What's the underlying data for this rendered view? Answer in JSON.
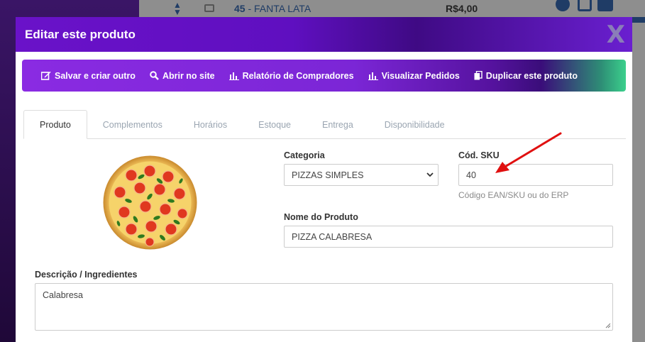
{
  "background_row": {
    "code": "45",
    "separator": " - ",
    "name": "FANTA LATA",
    "price": "R$4,00"
  },
  "modal": {
    "title": "Editar este produto",
    "close_label": "X"
  },
  "toolbar": {
    "items": [
      {
        "label": "Salvar e criar outro",
        "icon": "edit-icon"
      },
      {
        "label": "Abrir no site",
        "icon": "search-icon"
      },
      {
        "label": "Relatório de Compradores",
        "icon": "bar-chart-icon"
      },
      {
        "label": "Visualizar Pedidos",
        "icon": "bar-chart-icon"
      },
      {
        "label": "Duplicar este produto",
        "icon": "copy-icon"
      }
    ]
  },
  "tabs": [
    {
      "label": "Produto",
      "active": true
    },
    {
      "label": "Complementos",
      "active": false
    },
    {
      "label": "Horários",
      "active": false
    },
    {
      "label": "Estoque",
      "active": false
    },
    {
      "label": "Entrega",
      "active": false
    },
    {
      "label": "Disponibilidade",
      "active": false
    }
  ],
  "form": {
    "categoria_label": "Categoria",
    "categoria_value": "PIZZAS SIMPLES",
    "sku_label": "Cód. SKU",
    "sku_value": "40",
    "sku_help": "Código EAN/SKU ou do ERP",
    "nome_label": "Nome do Produto",
    "nome_value": "PIZZA CALABRESA",
    "descricao_label": "Descrição / Ingredientes",
    "descricao_value": "Calabresa"
  },
  "colors": {
    "header_purple": "#6a12c9",
    "toolbar_start": "#8a2be2",
    "toolbar_end": "#3bd08c",
    "annotation_arrow": "#e01010"
  }
}
